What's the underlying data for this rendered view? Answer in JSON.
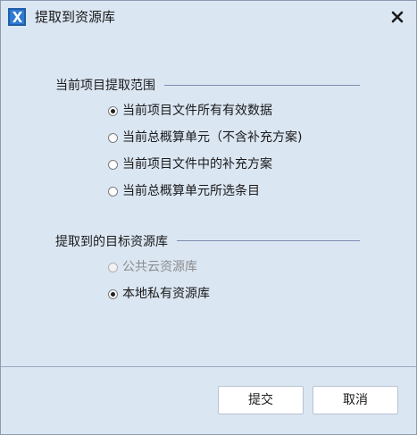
{
  "window": {
    "title": "提取到资源库",
    "icon": "app-logo-icon",
    "close_icon": "close-icon"
  },
  "range_group": {
    "title": "当前项目提取范围",
    "options": [
      {
        "label": "当前项目文件所有有效数据",
        "checked": true,
        "disabled": false
      },
      {
        "label": "当前总概算单元（不含补充方案)",
        "checked": false,
        "disabled": false
      },
      {
        "label": "当前项目文件中的补充方案",
        "checked": false,
        "disabled": false
      },
      {
        "label": "当前总概算单元所选条目",
        "checked": false,
        "disabled": false
      }
    ]
  },
  "target_group": {
    "title": "提取到的目标资源库",
    "options": [
      {
        "label": "公共云资源库",
        "checked": false,
        "disabled": true
      },
      {
        "label": "本地私有资源库",
        "checked": true,
        "disabled": false
      }
    ]
  },
  "buttons": {
    "submit": "提交",
    "cancel": "取消"
  },
  "colors": {
    "background": "#dbe6f3",
    "icon_blue": "#1f5fa8",
    "disabled_text": "#8c8c8c"
  }
}
